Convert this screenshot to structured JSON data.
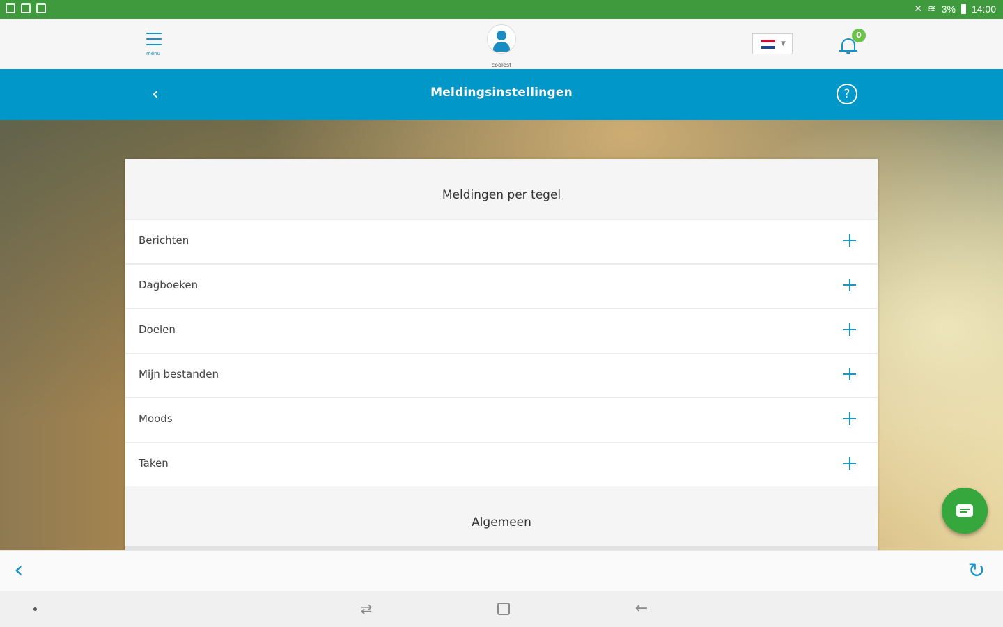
{
  "status_bar": {
    "time": "14:00",
    "battery": "3%"
  },
  "app_bar": {
    "menu_label": "menu",
    "user_name": "coolest",
    "notification_count": "0",
    "language_flag": "nl-flag"
  },
  "title_bar": {
    "back_glyph": "‹",
    "title": "Meldingsinstellingen",
    "help_glyph": "?"
  },
  "card": {
    "section1_title": "Meldingen per tegel",
    "items": [
      {
        "label": "Berichten"
      },
      {
        "label": "Dagboeken"
      },
      {
        "label": "Doelen"
      },
      {
        "label": "Mijn bestanden"
      },
      {
        "label": "Moods"
      },
      {
        "label": "Taken"
      }
    ],
    "section2_title": "Algemeen"
  },
  "bottom_bar": {
    "back_glyph": "‹",
    "reload_glyph": "↻"
  },
  "nav_bar": {
    "recents_glyph": "⇄",
    "back_glyph": "←"
  },
  "colors": {
    "status_bar": "#3f9a3e",
    "title_bar": "#0197c9",
    "accent": "#1b94c8",
    "fab": "#35a73c",
    "badge": "#6cc24a"
  }
}
